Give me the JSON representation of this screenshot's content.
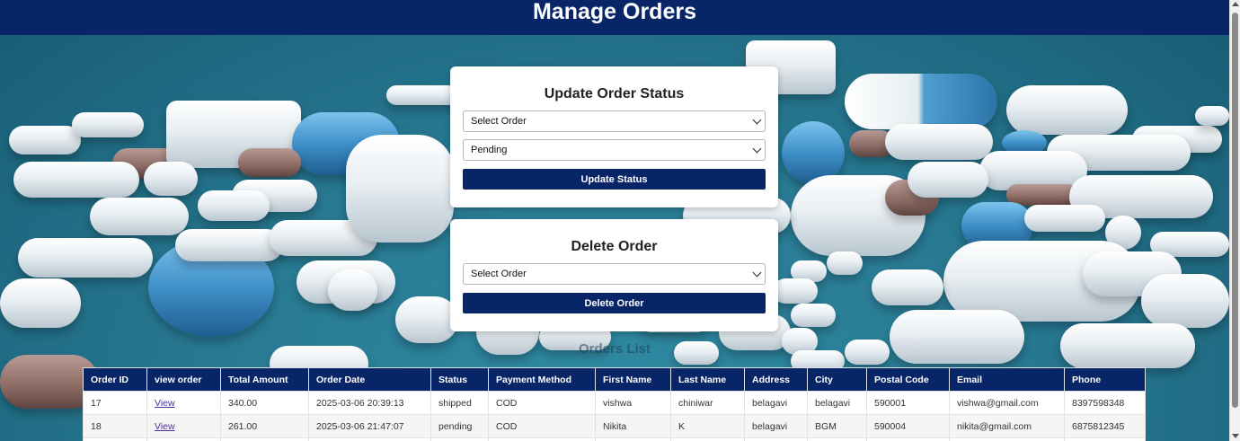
{
  "header": {
    "title": "Manage Orders"
  },
  "update_card": {
    "title": "Update Order Status",
    "order_select": "Select Order",
    "status_select": "Pending",
    "button": "Update Status"
  },
  "delete_card": {
    "title": "Delete Order",
    "order_select": "Select Order",
    "button": "Delete Order"
  },
  "orders_list": {
    "title": "Orders List",
    "columns": [
      "Order ID",
      "view order",
      "Total Amount",
      "Order Date",
      "Status",
      "Payment Method",
      "First Name",
      "Last Name",
      "Address",
      "City",
      "Postal Code",
      "Email",
      "Phone"
    ],
    "rows": [
      [
        "17",
        "View",
        "340.00",
        "2025-03-06 20:39:13",
        "shipped",
        "COD",
        "vishwa",
        "chiniwar",
        "belagavi",
        "belagavi",
        "590001",
        "vishwa@gmail.com",
        "8397598348"
      ],
      [
        "18",
        "View",
        "261.00",
        "2025-03-06 21:47:07",
        "pending",
        "COD",
        "Nikita",
        "K",
        "belagavi",
        "BGM",
        "590004",
        "nikita@gmail.com",
        "6875812345"
      ],
      [
        "",
        "",
        "",
        "",
        "",
        "",
        "",
        "",
        "",
        "",
        "",
        "",
        ""
      ]
    ]
  },
  "colors": {
    "primary": "#082567",
    "background": "#2a7c95"
  }
}
